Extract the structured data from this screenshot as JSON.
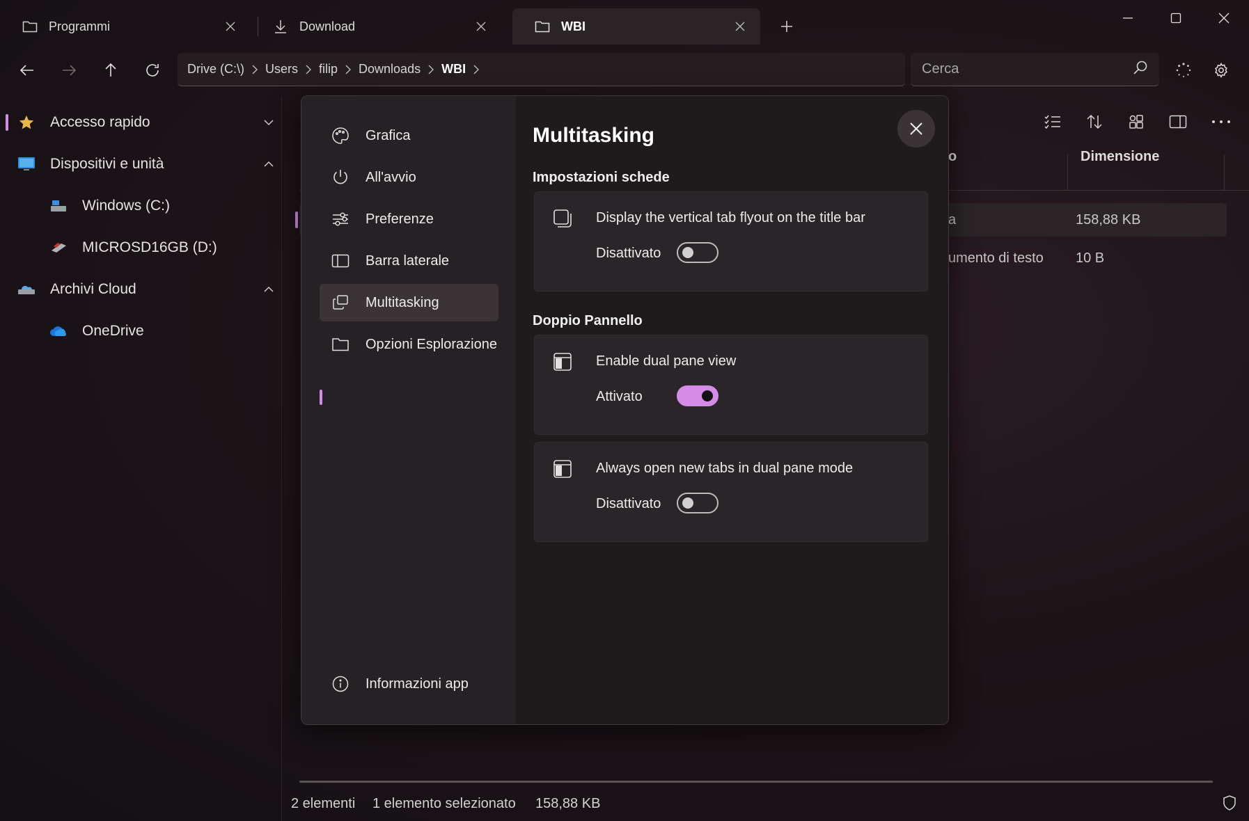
{
  "tabs": [
    {
      "label": "Programmi",
      "icon": "folder-icon"
    },
    {
      "label": "Download",
      "icon": "download-icon"
    },
    {
      "label": "WBI",
      "icon": "folder-icon"
    }
  ],
  "breadcrumb": [
    "Drive (C:\\)",
    "Users",
    "filip",
    "Downloads",
    "WBI"
  ],
  "search": {
    "placeholder": "Cerca"
  },
  "sidebar": {
    "items": [
      {
        "label": "Accesso rapido",
        "icon": "star-icon"
      },
      {
        "label": "Dispositivi e unità",
        "icon": "monitor-icon"
      },
      {
        "label": "Windows (C:)",
        "icon": "drive-icon"
      },
      {
        "label": "MICROSD16GB (D:)",
        "icon": "sd-card-icon"
      },
      {
        "label": "Archivi Cloud",
        "icon": "cloud-drive-icon"
      },
      {
        "label": "OneDrive",
        "icon": "onedrive-icon"
      }
    ]
  },
  "table": {
    "headers": {
      "type": "o",
      "size": "Dimensione"
    },
    "rows": [
      {
        "type": "a",
        "size": "158,88 KB"
      },
      {
        "type": "umento di testo",
        "size": "10 B"
      }
    ]
  },
  "status": {
    "count": "2 elementi",
    "selected": "1 elemento selezionato",
    "size": "158,88 KB"
  },
  "settings": {
    "title": "Multitasking",
    "nav": [
      {
        "label": "Grafica",
        "icon": "palette-icon"
      },
      {
        "label": "All'avvio",
        "icon": "power-icon"
      },
      {
        "label": "Preferenze",
        "icon": "sliders-icon"
      },
      {
        "label": "Barra laterale",
        "icon": "sidebar-icon"
      },
      {
        "label": "Multitasking",
        "icon": "multitask-icon"
      },
      {
        "label": "Opzioni Esplorazione",
        "icon": "folder-icon"
      }
    ],
    "about": {
      "label": "Informazioni app",
      "icon": "info-icon"
    },
    "sections": {
      "tabs_title": "Impostazioni schede",
      "dual_title": "Doppio Pannello"
    },
    "cards": [
      {
        "title": "Display the vertical tab flyout on the title bar",
        "state": "Disattivato",
        "on": false
      },
      {
        "title": "Enable dual pane view",
        "state": "Attivato",
        "on": true
      },
      {
        "title": "Always open new tabs in dual pane mode",
        "state": "Disattivato",
        "on": false
      }
    ]
  },
  "colors": {
    "accent": "#d58be8"
  }
}
